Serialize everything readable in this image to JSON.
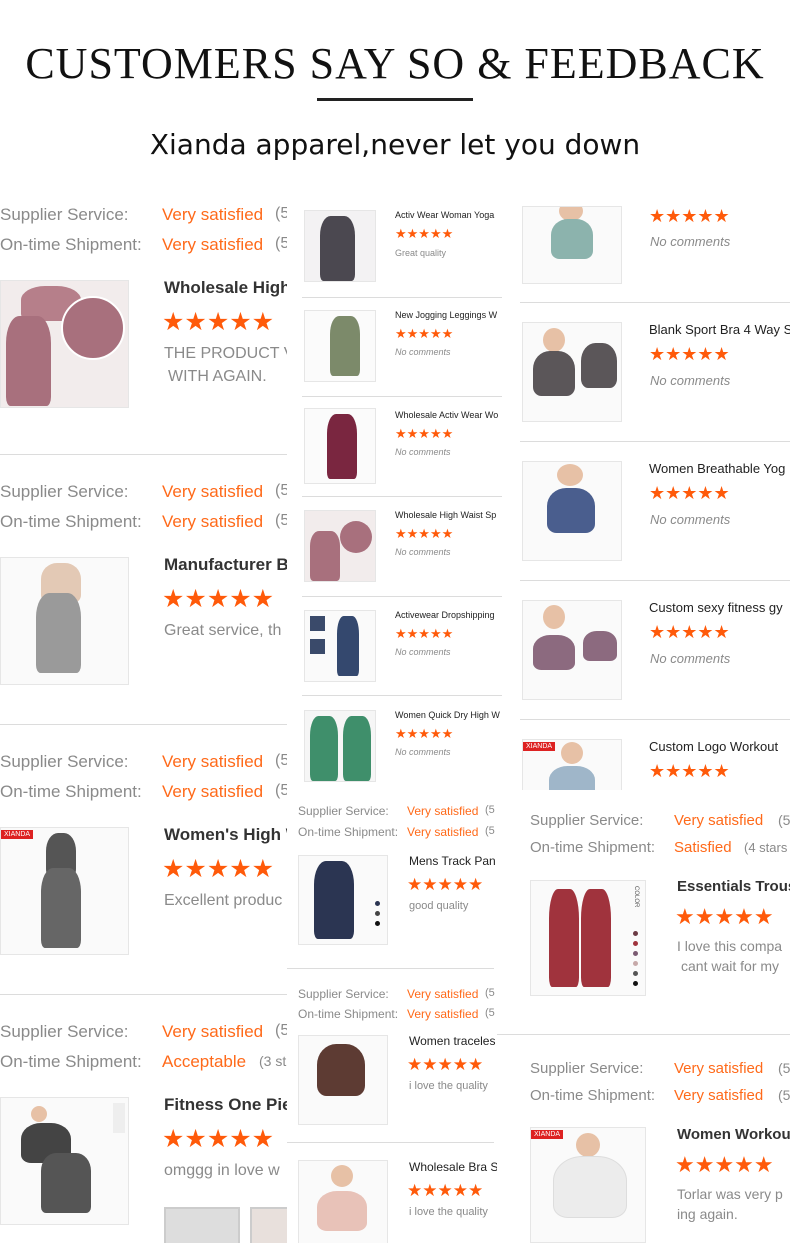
{
  "header": {
    "title": "CUSTOMERS SAY SO & FEEDBACK",
    "subtitle": "Xianda apparel,never let you down"
  },
  "colors": {
    "star": "#ff5a0a",
    "accent_text": "#ff6a1a",
    "label_gray": "#8a8a8a",
    "title": "#111111"
  },
  "left_reviews": [
    {
      "supplier_label": "Supplier Service:",
      "supplier_value": "Very satisfied",
      "supplier_count": "(5",
      "shipment_label": "On-time Shipment:",
      "shipment_value": "Very satisfied",
      "shipment_count": "(5",
      "product": "Wholesale High",
      "stars": "★★★★★",
      "comment_line1": "THE PRODUCT V",
      "comment_line2": "WITH AGAIN."
    },
    {
      "supplier_label": "Supplier Service:",
      "supplier_value": "Very satisfied",
      "supplier_count": "(5",
      "shipment_label": "On-time Shipment:",
      "shipment_value": "Very satisfied",
      "shipment_count": "(5",
      "product": "Manufacturer Bu",
      "stars": "★★★★★",
      "comment_line1": "Great service, th",
      "comment_line2": ""
    },
    {
      "supplier_label": "Supplier Service:",
      "supplier_value": "Very satisfied",
      "supplier_count": "(5",
      "shipment_label": "On-time Shipment:",
      "shipment_value": "Very satisfied",
      "shipment_count": "(5",
      "product": "Women's High W",
      "stars": "★★★★★",
      "comment_line1": "Excellent produc",
      "comment_line2": ""
    },
    {
      "supplier_label": "Supplier Service:",
      "supplier_value": "Very satisfied",
      "supplier_count": "(5",
      "shipment_label": "On-time Shipment:",
      "shipment_value": "Acceptable",
      "shipment_count": "(3 st",
      "product": "Fitness One Pie",
      "stars": "★★★★★",
      "comment_line1": "omggg in love w",
      "comment_line2": ""
    }
  ],
  "middle_list": [
    {
      "title": "Activ Wear Woman Yoga",
      "stars": "★★★★★",
      "comment": "Great quality"
    },
    {
      "title": "New Jogging Leggings W",
      "stars": "★★★★★",
      "comment": "No comments"
    },
    {
      "title": "Wholesale Activ Wear Wo",
      "stars": "★★★★★",
      "comment": "No comments"
    },
    {
      "title": "Wholesale High Waist Sp",
      "stars": "★★★★★",
      "comment": "No comments"
    },
    {
      "title": "Activewear Dropshipping",
      "stars": "★★★★★",
      "comment": "No comments"
    },
    {
      "title": "Women Quick Dry High W",
      "stars": "★★★★★",
      "comment": "No comments"
    }
  ],
  "right_list": [
    {
      "title": "",
      "stars": "★★★★★",
      "comment": "No comments"
    },
    {
      "title": "Blank Sport Bra 4 Way S",
      "stars": "★★★★★",
      "comment": "No comments"
    },
    {
      "title": "Women Breathable Yog",
      "stars": "★★★★★",
      "comment": "No comments"
    },
    {
      "title": "Custom sexy fitness gy",
      "stars": "★★★★★",
      "comment": "No comments"
    },
    {
      "title": "Custom Logo Workout",
      "stars": "★★★★★",
      "comment": ""
    }
  ],
  "middle_reviews": [
    {
      "supplier_label": "Supplier Service:",
      "supplier_value": "Very satisfied",
      "supplier_count": "(5",
      "shipment_label": "On-time Shipment:",
      "shipment_value": "Very satisfied",
      "shipment_count": "(5",
      "product": "Mens Track Pan",
      "stars": "★★★★★",
      "comment": "good quality"
    },
    {
      "supplier_label": "Supplier Service:",
      "supplier_value": "Very satisfied",
      "supplier_count": "(5",
      "shipment_label": "On-time Shipment:",
      "shipment_value": "Very satisfied",
      "shipment_count": "(5",
      "product": "Women traceles",
      "stars": "★★★★★",
      "comment": "i love the quality"
    },
    {
      "product": "Wholesale Bra S",
      "stars": "★★★★★",
      "comment": "i love the quality"
    }
  ],
  "right_reviews": [
    {
      "supplier_label": "Supplier Service:",
      "supplier_value": "Very satisfied",
      "supplier_count": "(5",
      "shipment_label": "On-time Shipment:",
      "shipment_value": "Satisfied",
      "shipment_count": "(4 stars",
      "product": "Essentials Trous",
      "stars": "★★★★★",
      "comment_line1": "I love this compa",
      "comment_line2": "cant wait for my"
    },
    {
      "supplier_label": "Supplier Service:",
      "supplier_value": "Very satisfied",
      "supplier_count": "(5",
      "shipment_label": "On-time Shipment:",
      "shipment_value": "Very satisfied",
      "shipment_count": "(5",
      "product": "Women Workout",
      "stars": "★★★★★",
      "comment_line1": "Torlar was very p",
      "comment_line2": "ing again."
    }
  ],
  "brand_logo": "XIANDA",
  "color_tag": "COLOR"
}
